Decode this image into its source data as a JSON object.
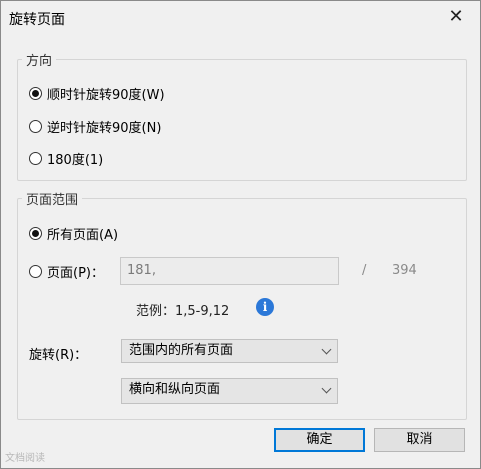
{
  "dialog": {
    "title": "旋转页面",
    "close": "✕"
  },
  "direction": {
    "label": "方向",
    "options": [
      {
        "label": "顺时针旋转90度(W)",
        "checked": true
      },
      {
        "label": "逆时针旋转90度(N)",
        "checked": false
      },
      {
        "label": "180度(1)",
        "checked": false
      }
    ]
  },
  "range": {
    "label": "页面范围",
    "all_pages": {
      "label": "所有页面(A)",
      "checked": true
    },
    "pages": {
      "label": "页面(P)：",
      "checked": false,
      "value": "181,",
      "separator": "/",
      "total": "394"
    },
    "example": "范例：1,5-9,12",
    "info_icon": "i"
  },
  "rotate": {
    "label": "旋转(R)：",
    "select1": {
      "value": "范围内的所有页面"
    },
    "select2": {
      "value": "横向和纵向页面"
    }
  },
  "buttons": {
    "ok": "确定",
    "cancel": "取消"
  },
  "watermark": "文档阅读"
}
